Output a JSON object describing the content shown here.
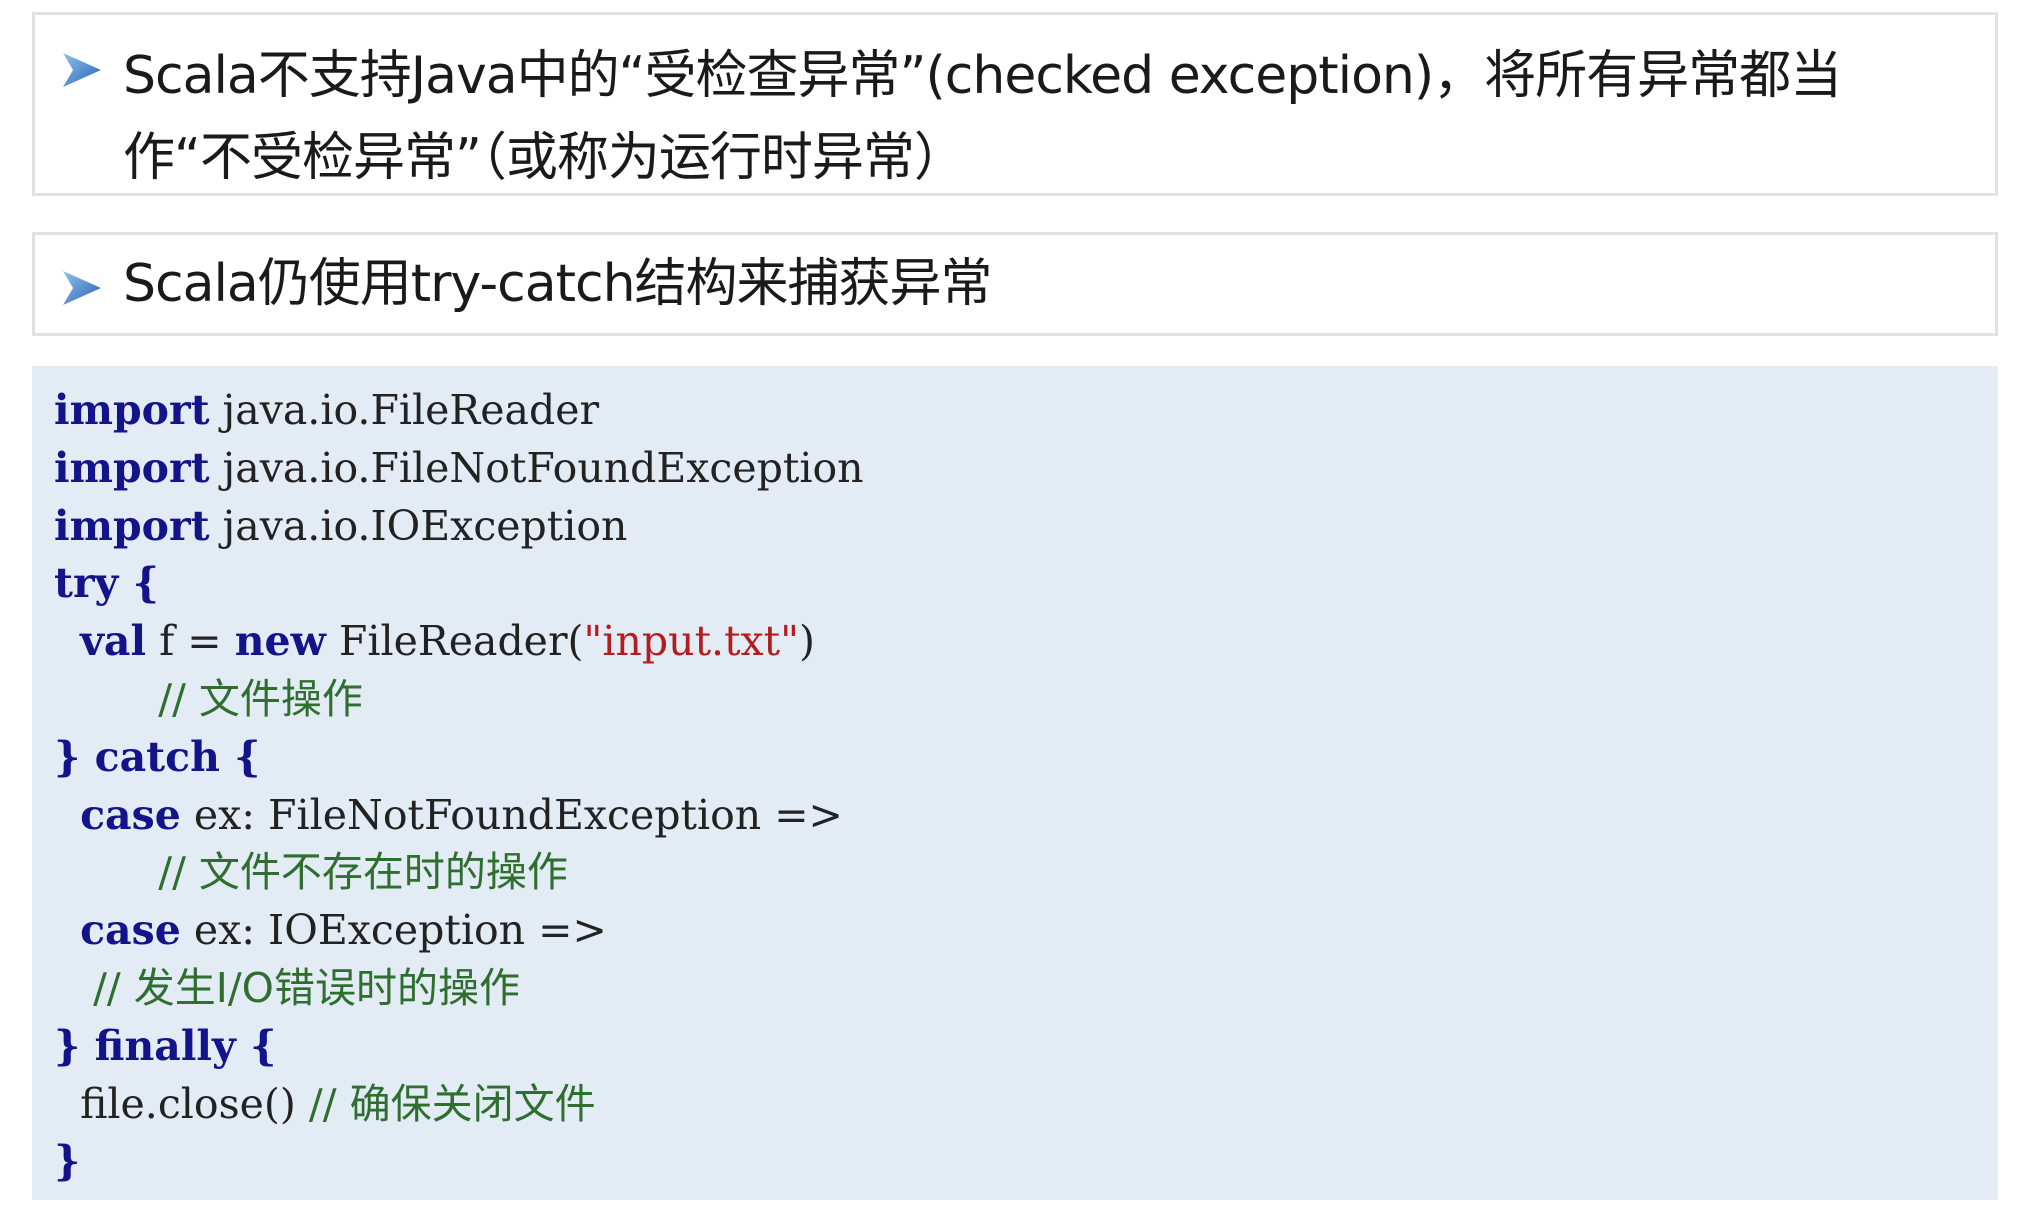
{
  "bullets": [
    {
      "icon": "arrow-bullet-icon",
      "lines": [
        "Scala不支持Java中的“受检查异常”(checked exception)，将所有异常都当",
        "作“不受检异常”（或称为运行时异常）"
      ]
    },
    {
      "icon": "arrow-bullet-icon",
      "lines": [
        "Scala仍使用try-catch结构来捕获异常"
      ]
    }
  ],
  "code": {
    "l1": {
      "kw": "import",
      "text": " java.io.FileReader"
    },
    "l2": {
      "kw": "import",
      "text": " java.io.FileNotFoundException"
    },
    "l3": {
      "kw": "import",
      "text": " java.io.IOException"
    },
    "l4": {
      "kw": "try {"
    },
    "l5": {
      "kw1": "val",
      "text1": " f = ",
      "kw2": "new",
      "text2": " FileReader(",
      "str": "\"input.txt\"",
      "text3": ")"
    },
    "l6": {
      "comment": "// 文件操作"
    },
    "l7": {
      "text": "} ",
      "kw": "catch {"
    },
    "l8": {
      "kw": "case",
      "text": " ex: FileNotFoundException =>"
    },
    "l9": {
      "comment": "// 文件不存在时的操作"
    },
    "l10": {
      "kw": "case",
      "text": " ex: IOException =>"
    },
    "l11": {
      "comment": "// 发生I/O错误时的操作"
    },
    "l12": {
      "text": "} ",
      "kw": "finally {"
    },
    "l13": {
      "text": "file.close() ",
      "comment": "// 确保关闭文件"
    },
    "l14": {
      "text": "}"
    }
  },
  "colors": {
    "keyword": "#14148a",
    "string": "#b31d1d",
    "comment": "#2e6e2e",
    "code_background": "#e3ebf4",
    "bullet_arrow": "#3b78c4"
  }
}
